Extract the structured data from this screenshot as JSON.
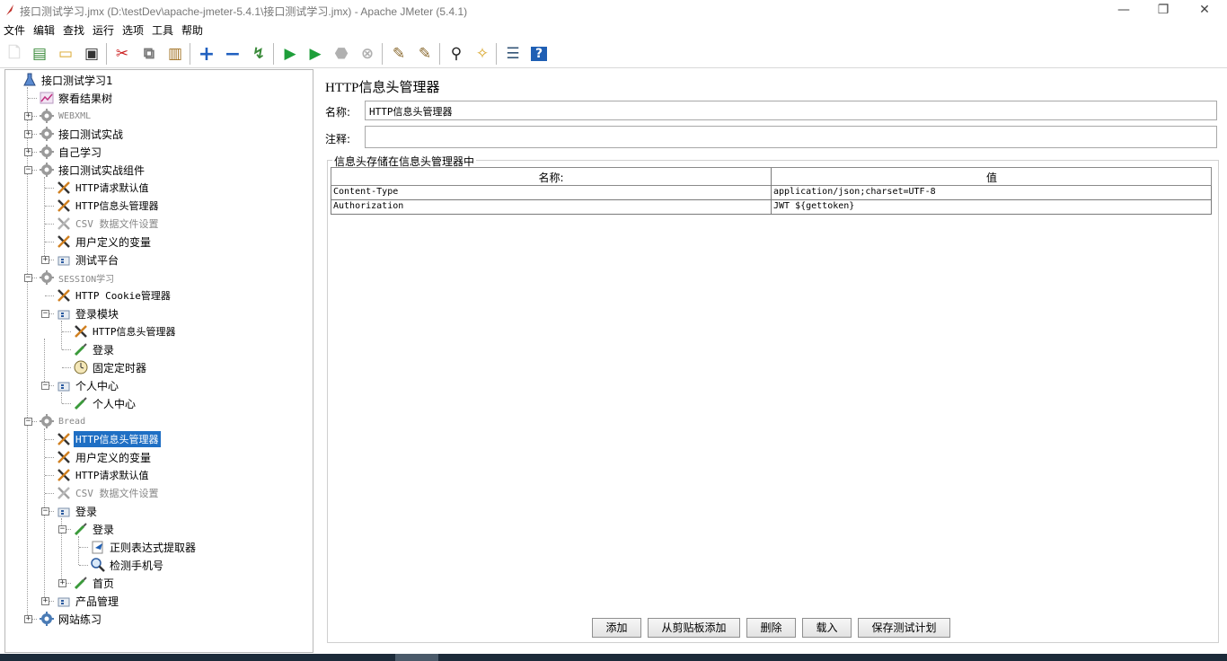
{
  "window": {
    "title": "接口测试学习.jmx (D:\\testDev\\apache-jmeter-5.4.1\\接口测试学习.jmx) - Apache JMeter (5.4.1)",
    "minimize": "—",
    "restore": "❐",
    "close": "✕"
  },
  "menu": [
    "文件",
    "编辑",
    "查找",
    "运行",
    "选项",
    "工具",
    "帮助"
  ],
  "toolbar": [
    {
      "name": "new-icon",
      "glyph": "🗋",
      "color": "#dddddd"
    },
    {
      "name": "templates-icon",
      "glyph": "▤",
      "color": "#3a8a3a"
    },
    {
      "name": "open-icon",
      "glyph": "▭",
      "color": "#d9a62a"
    },
    {
      "name": "save-icon",
      "glyph": "▣",
      "color": "#333333"
    },
    {
      "name": "cut-icon",
      "glyph": "✂",
      "color": "#cc2222"
    },
    {
      "name": "copy-icon",
      "glyph": "⧉",
      "color": "#777777"
    },
    {
      "name": "paste-icon",
      "glyph": "▥",
      "color": "#a07020"
    },
    {
      "name": "expand-icon",
      "glyph": "+",
      "color": "#2060c0"
    },
    {
      "name": "collapse-icon",
      "glyph": "−",
      "color": "#2060c0"
    },
    {
      "name": "toggle-icon",
      "glyph": "↯",
      "color": "#3a8a3a"
    },
    {
      "name": "start-icon",
      "glyph": "▶",
      "color": "#1e9e3a"
    },
    {
      "name": "start-no-pause-icon",
      "glyph": "▶",
      "color": "#1e9e3a"
    },
    {
      "name": "stop-icon",
      "glyph": "⬣",
      "color": "#b0b0b0"
    },
    {
      "name": "shutdown-icon",
      "glyph": "⊗",
      "color": "#b0b0b0"
    },
    {
      "name": "clear-icon",
      "glyph": "✎",
      "color": "#8a6a30"
    },
    {
      "name": "clear-all-icon",
      "glyph": "✎",
      "color": "#8a6a30"
    },
    {
      "name": "search-icon",
      "glyph": "⚲",
      "color": "#222222"
    },
    {
      "name": "reset-search-icon",
      "glyph": "✧",
      "color": "#d9a62a"
    },
    {
      "name": "function-helper-icon",
      "glyph": "☰",
      "color": "#335577"
    },
    {
      "name": "help-icon",
      "glyph": "?",
      "color": "#1f5fb4"
    }
  ],
  "tree": [
    {
      "label": "接口测试学习1",
      "icon": "flask-icon",
      "style": "normal",
      "x": 0
    },
    {
      "label": "察看结果树",
      "icon": "chart-icon",
      "style": "normal",
      "x": 1
    },
    {
      "label": "WEBXML",
      "icon": "gear-icon",
      "style": "dim",
      "x": 1,
      "exp": "+"
    },
    {
      "label": "接口测试实战",
      "icon": "gear-icon",
      "style": "normal",
      "x": 1,
      "exp": "+"
    },
    {
      "label": "自己学习",
      "icon": "gear-icon",
      "style": "normal",
      "x": 1,
      "exp": "+"
    },
    {
      "label": "接口测试实战组件",
      "icon": "gear-icon",
      "style": "normal",
      "x": 1,
      "exp": "−"
    },
    {
      "label": "HTTP请求默认值",
      "icon": "wrench-icon",
      "style": "mono",
      "x": 2
    },
    {
      "label": "HTTP信息头管理器",
      "icon": "wrench-icon",
      "style": "mono",
      "x": 2
    },
    {
      "label": "CSV 数据文件设置",
      "icon": "wrench-icon-dim",
      "style": "dimtext",
      "x": 2
    },
    {
      "label": "用户定义的变量",
      "icon": "wrench-icon",
      "style": "normal",
      "x": 2
    },
    {
      "label": "测试平台",
      "icon": "controller-icon",
      "style": "normal",
      "x": 2,
      "exp": "+"
    },
    {
      "label": "SESSION学习",
      "icon": "gear-icon",
      "style": "dim",
      "x": 1,
      "exp": "−"
    },
    {
      "label": "HTTP Cookie管理器",
      "icon": "wrench-icon",
      "style": "mono",
      "x": 2
    },
    {
      "label": "登录模块",
      "icon": "controller-icon",
      "style": "normal",
      "x": 2,
      "exp": "−"
    },
    {
      "label": "HTTP信息头管理器",
      "icon": "wrench-icon",
      "style": "mono",
      "x": 3
    },
    {
      "label": "登录",
      "icon": "pipette-icon",
      "style": "normal",
      "x": 3
    },
    {
      "label": "固定定时器",
      "icon": "timer-icon",
      "style": "normal",
      "x": 3
    },
    {
      "label": "个人中心",
      "icon": "controller-icon",
      "style": "normal",
      "x": 2,
      "exp": "−"
    },
    {
      "label": "个人中心",
      "icon": "pipette-icon",
      "style": "normal",
      "x": 3
    },
    {
      "label": "Bread",
      "icon": "gear-icon",
      "style": "dim",
      "x": 1,
      "exp": "−"
    },
    {
      "label": "HTTP信息头管理器",
      "icon": "wrench-icon",
      "style": "selected",
      "x": 2
    },
    {
      "label": "用户定义的变量",
      "icon": "wrench-icon",
      "style": "normal",
      "x": 2
    },
    {
      "label": "HTTP请求默认值",
      "icon": "wrench-icon",
      "style": "mono",
      "x": 2
    },
    {
      "label": "CSV 数据文件设置",
      "icon": "wrench-icon-dim",
      "style": "dimtext",
      "x": 2
    },
    {
      "label": "登录",
      "icon": "controller-icon",
      "style": "normal",
      "x": 2,
      "exp": "−"
    },
    {
      "label": "登录",
      "icon": "pipette-icon",
      "style": "normal",
      "x": 3,
      "exp": "−"
    },
    {
      "label": "正则表达式提取器",
      "icon": "extractor-icon",
      "style": "normal",
      "x": 4
    },
    {
      "label": "检测手机号",
      "icon": "magnifier-icon",
      "style": "normal",
      "x": 4
    },
    {
      "label": "首页",
      "icon": "pipette-icon",
      "style": "normal",
      "x": 3,
      "exp": "+"
    },
    {
      "label": "产品管理",
      "icon": "controller-icon",
      "style": "normal",
      "x": 2,
      "exp": "+"
    },
    {
      "label": "网站练习",
      "icon": "gear-blue-icon",
      "style": "normal",
      "x": 1,
      "exp": "+"
    }
  ],
  "editor": {
    "heading": "HTTP信息头管理器",
    "name_label": "名称:",
    "name_value": "HTTP信息头管理器",
    "comment_label": "注释:",
    "comment_value": "",
    "group_title": "信息头存储在信息头管理器中",
    "columns": [
      "名称:",
      "值"
    ],
    "rows": [
      [
        "Content-Type",
        "application/json;charset=UTF-8"
      ],
      [
        "Authorization",
        "JWT ${gettoken}"
      ]
    ],
    "buttons": [
      "添加",
      "从剪贴板添加",
      "删除",
      "载入",
      "保存测试计划"
    ]
  }
}
